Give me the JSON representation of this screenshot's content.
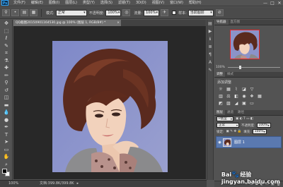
{
  "app": {
    "logo": "Ps",
    "menu": [
      "文件(F)",
      "编辑(E)",
      "图像(I)",
      "图层(L)",
      "类型(Y)",
      "选择(S)",
      "滤镜(T)",
      "3D(D)",
      "视图(V)",
      "窗口(W)",
      "帮助(H)"
    ],
    "window_controls": [
      "—",
      "□",
      "✕"
    ]
  },
  "options_bar": {
    "mode_label": "模式:",
    "mode_value": "正常",
    "opacity_label": "不透明度:",
    "opacity_value": "100%",
    "flow_label": "流量:",
    "flow_value": "100%",
    "sample_label": "样本:",
    "sample_value": "当前图层"
  },
  "document": {
    "tab_title": "QQ截图20150901164530.jpg @ 100% (图层 1, RGB/8#) *",
    "zoom": "100%",
    "doc_info": "文档:399.8K/399.8K"
  },
  "panels": {
    "navigator_tabs": [
      "导航器",
      "直方图"
    ],
    "navigator_zoom": "100%",
    "adjust_tabs": [
      "调整",
      "样式"
    ],
    "adjust_label": "添加调整",
    "layers_tabs": [
      "图层",
      "通道",
      "路径"
    ],
    "layers_filter_label": "P类型",
    "blend_mode": "正常",
    "opacity_label": "不透明度:",
    "opacity_value": "100%",
    "lock_label": "锁定:",
    "fill_label": "填充:",
    "fill_value": "100%",
    "layer_name": "图层 1"
  },
  "watermark": {
    "text": "jingyan.baidu.com",
    "brand": "Bai",
    "brand2": "经验"
  },
  "colors": {
    "accent_blue": "#5a79b0",
    "navigator_frame": "#e8272a",
    "photo_bg": "#8b93c9"
  }
}
